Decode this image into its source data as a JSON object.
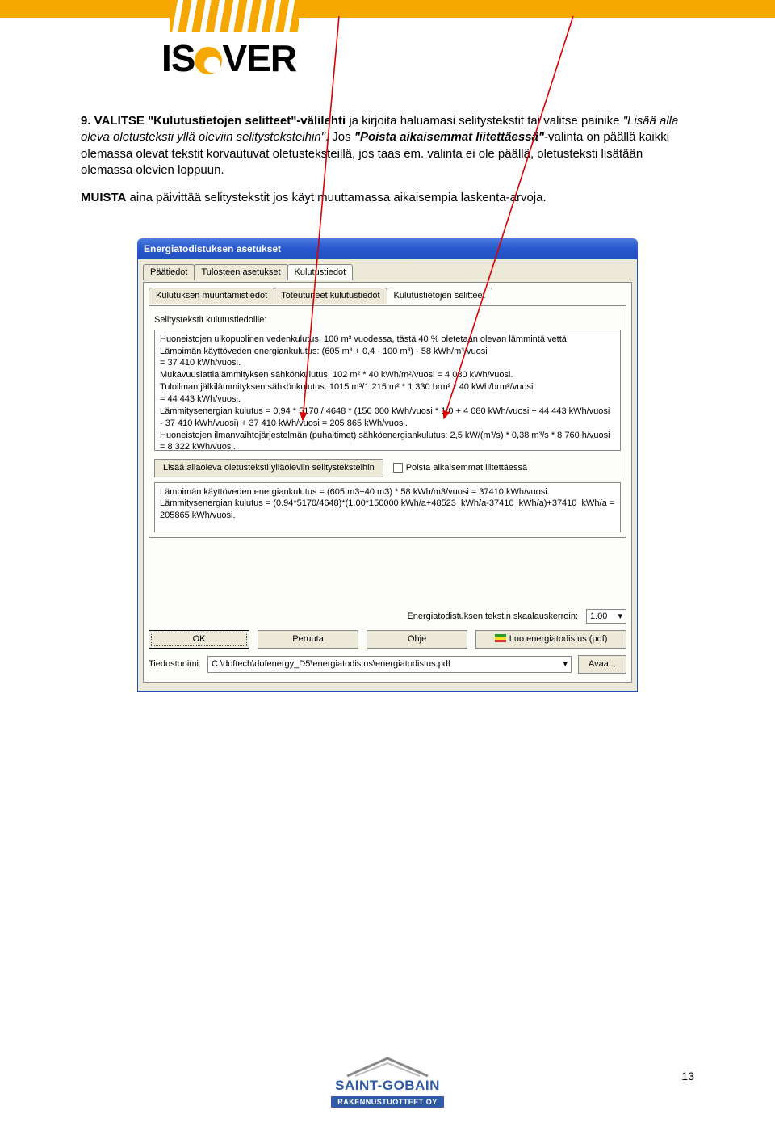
{
  "header": {
    "brand": "ISOVER"
  },
  "doc": {
    "p1_lead": "9. VALITSE \"Kulutustietojen selitteet\"-välilehti",
    "p1_rest": " ja kirjoita haluamasi selitystekstit tai valitse painike ",
    "p1_btn": "\"Lisää alla oleva oletusteksti yllä oleviin selitysteksteihin\"",
    "p1_rest2": ". Jos ",
    "p1_opt": "\"Poista aikaisemmat liitettäessä\"",
    "p1_rest3": "-valinta on päällä kaikki olemassa olevat tekstit korvautuvat oletusteksteillä, jos taas em. valinta ei ole päällä, oletusteksti lisätään olemassa olevien loppuun.",
    "p2_lead": "MUISTA",
    "p2_rest": " aina päivittää selitystekstit jos käyt muuttamassa aikaisempia laskenta-arvoja.",
    "page_number": "13"
  },
  "dialog": {
    "title": "Energiatodistuksen asetukset",
    "tabs1": [
      "Päätiedot",
      "Tulosteen asetukset",
      "Kulutustiedot"
    ],
    "tabs1_active": 2,
    "tabs2": [
      "Kulutuksen muuntamistiedot",
      "Toteutuneet kulutustiedot",
      "Kulutustietojen selitteet"
    ],
    "tabs2_active": 2,
    "field_label": "Selitystekstit kulutustiedoille:",
    "main_text": "Huoneistojen ulkopuolinen vedenkulutus: 100 m³ vuodessa, tästä 40 % oletetaan olevan lämmintä vettä.\nLämpimän käyttöveden energiankulutus: (605 m³ + 0,4 · 100 m³) · 58 kWh/m³/vuosi\n= 37 410 kWh/vuosi.\nMukavuuslattialämmityksen sähkönkulutus: 102 m² * 40 kWh/m²/vuosi = 4 080 kWh/vuosi.\nTuloilman jälkilämmityksen sähkönkulutus: 1015 m³/1 215 m² * 1 330 brm² * 40 kWh/brm²/vuosi\n= 44 443 kWh/vuosi.\nLämmitysenergian kulutus = 0,94 * 5170 / 4648 * (150 000 kWh/vuosi * 1,0 + 4 080 kWh/vuosi + 44 443 kWh/vuosi - 37 410 kWh/vuosi) + 37 410 kWh/vuosi = 205 865 kWh/vuosi.\nHuoneistojen ilmanvaihtojärjestelmän (puhaltimet) sähköenergiankulutus: 2,5 kW/(m³/s) * 0,38 m³/s * 8 760 h/vuosi = 8 322 kWh/vuosi.",
    "add_button": "Lisää allaoleva oletusteksti ylläoleviin selitysteksteihin",
    "checkbox_label": "Poista aikaisemmat liitettäessä",
    "lower_text": "Lämpimän käyttöveden energiankulutus = (605 m3+40 m3) * 58 kWh/m3/vuosi = 37410 kWh/vuosi.\nLämmitysenergian kulutus = (0.94*5170/4648)*(1.00*150000 kWh/a+48523  kWh/a-37410  kWh/a)+37410  kWh/a = 205865 kWh/vuosi.",
    "scale_label": "Energiatodistuksen tekstin skaalauskerroin:",
    "scale_value": "1.00",
    "buttons": {
      "ok": "OK",
      "cancel": "Peruuta",
      "help": "Ohje",
      "generate": "Luo energiatodistus (pdf)"
    },
    "file_label": "Tiedostonimi:",
    "file_value": "C:\\doftech\\dofenergy_D5\\energiatodistus\\energiatodistus.pdf",
    "open_btn": "Avaa..."
  },
  "footer": {
    "company": "SAINT-GOBAIN",
    "sub": "RAKENNUSTUOTTEET OY"
  }
}
